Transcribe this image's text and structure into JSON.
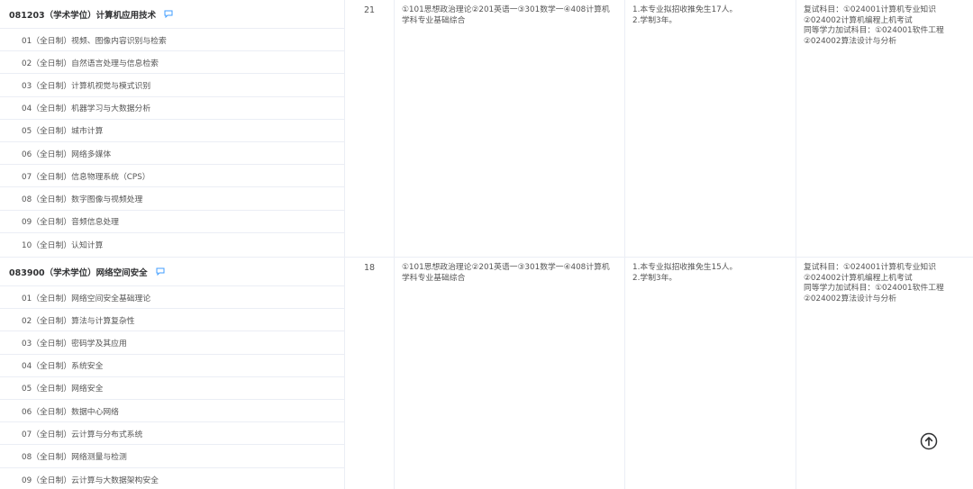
{
  "programs": [
    {
      "major": "081203（学术学位）计算机应用技术",
      "enrollment": "21",
      "exam_subjects": "①101思想政治理论②201英语一③301数学一④408计算机学科专业基础综合",
      "notes_line1": "1.本专业拟招收推免生17人。",
      "notes_line2": "2.学制3年。",
      "retest_line1": "复试科目：①024001计算机专业知识",
      "retest_line2": "②024002计算机编程上机考试",
      "retest_line3": "同等学力加试科目：①024001软件工程",
      "retest_line4": "②024002算法设计与分析",
      "directions": [
        "01（全日制）视频、图像内容识别与检索",
        "02（全日制）自然语言处理与信息检索",
        "03（全日制）计算机视觉与模式识别",
        "04（全日制）机器学习与大数据分析",
        "05（全日制）城市计算",
        "06（全日制）网络多媒体",
        "07（全日制）信息物理系统（CPS）",
        "08（全日制）数字图像与视频处理",
        "09（全日制）音频信息处理",
        "10（全日制）认知计算"
      ]
    },
    {
      "major": "083900（学术学位）网络空间安全",
      "enrollment": "18",
      "exam_subjects": "①101思想政治理论②201英语一③301数学一④408计算机学科专业基础综合",
      "notes_line1": "1.本专业拟招收推免生15人。",
      "notes_line2": "2.学制3年。",
      "retest_line1": "复试科目：①024001计算机专业知识",
      "retest_line2": "②024002计算机编程上机考试",
      "retest_line3": "同等学力加试科目：①024001软件工程",
      "retest_line4": "②024002算法设计与分析",
      "directions": [
        "01（全日制）网络空间安全基础理论",
        "02（全日制）算法与计算复杂性",
        "03（全日制）密码学及其应用",
        "04（全日制）系统安全",
        "05（全日制）网络安全",
        "06（全日制）数据中心网络",
        "07（全日制）云计算与分布式系统",
        "08（全日制）网络测量与检测",
        "09（全日制）云计算与大数据架构安全"
      ]
    }
  ],
  "icons": {
    "comment": "comment-icon",
    "back_to_top": "arrow-up-circle-icon"
  },
  "colors": {
    "accent": "#409eff",
    "border": "#ebeef5"
  }
}
